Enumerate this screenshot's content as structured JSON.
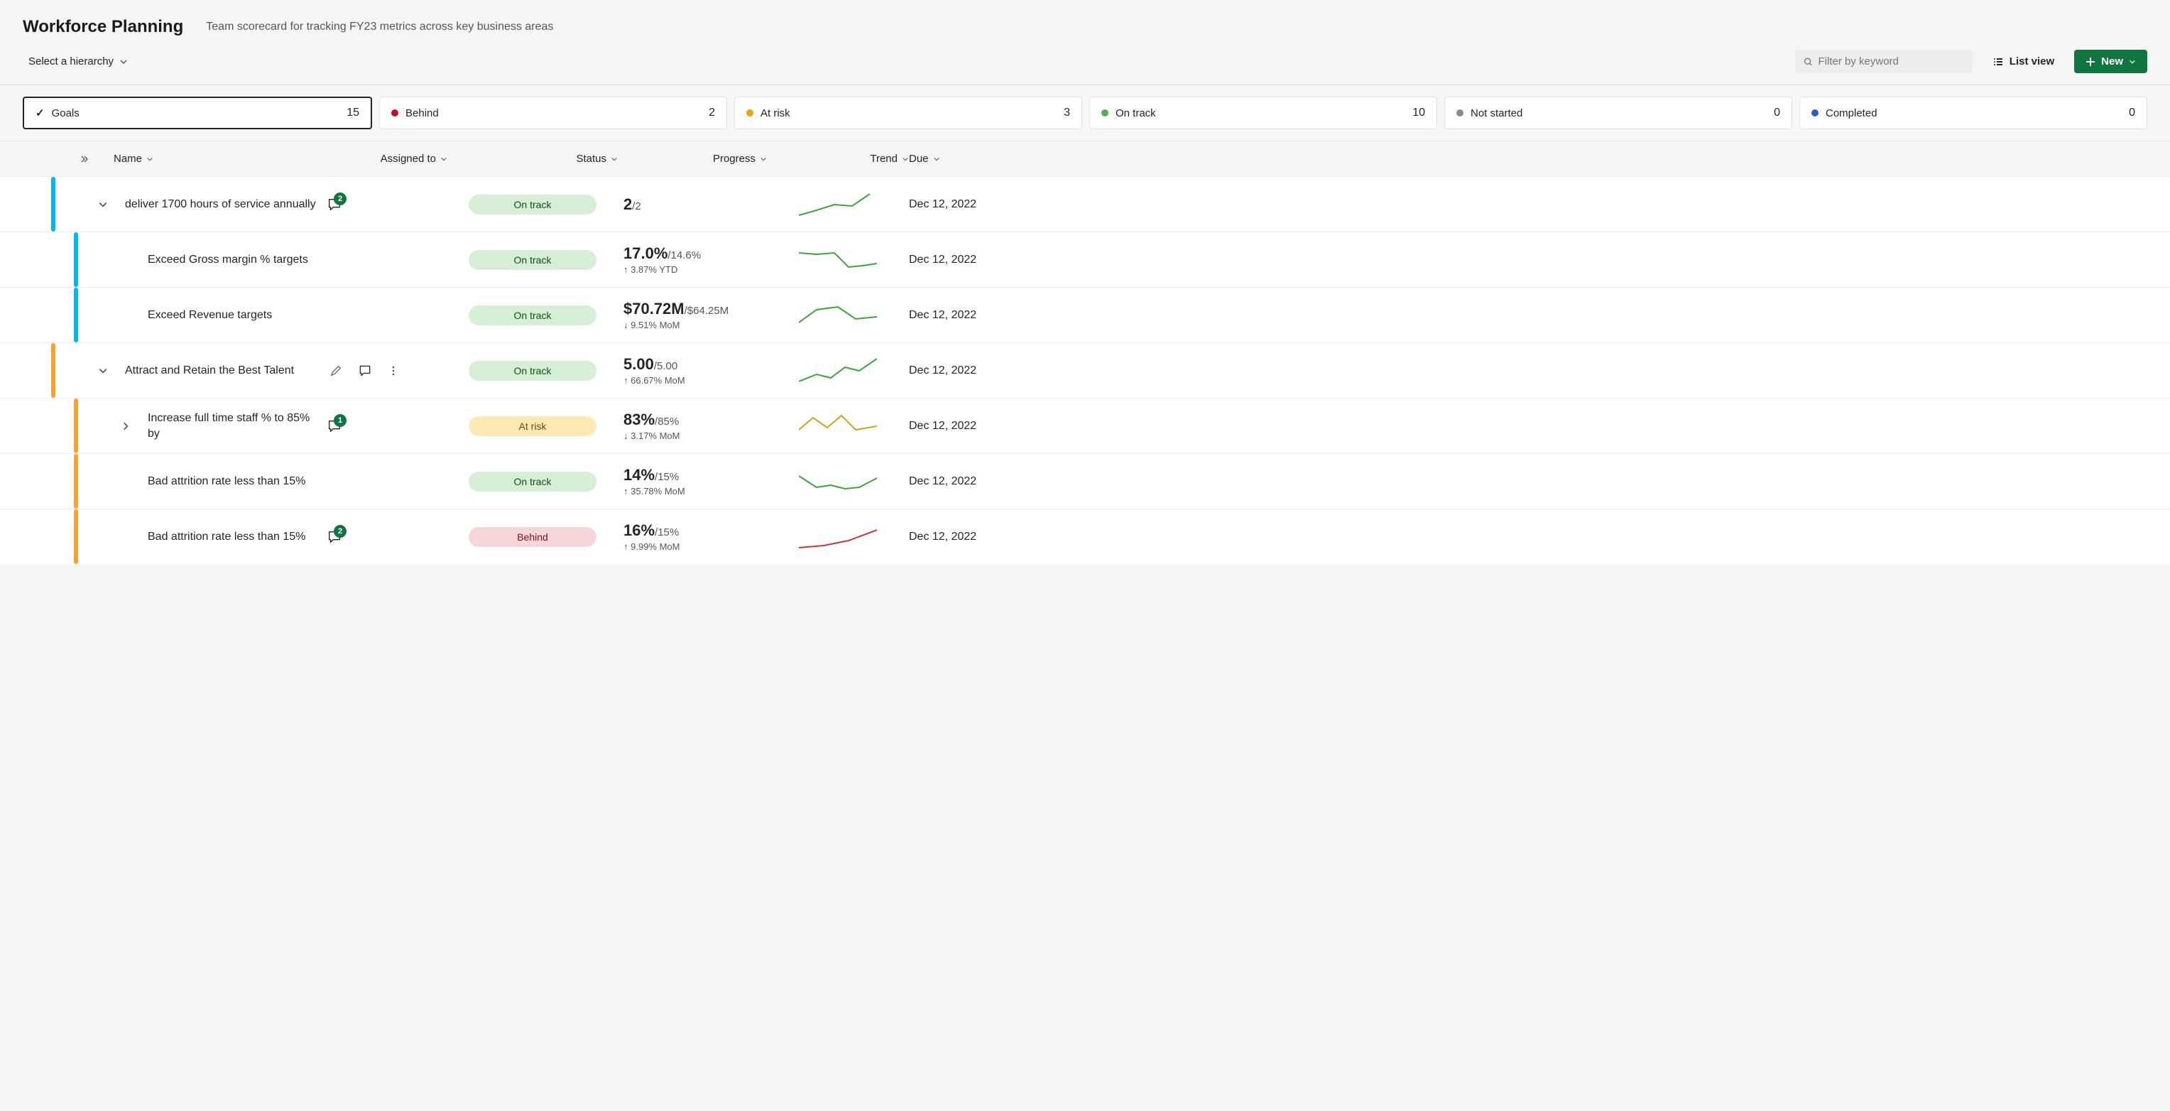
{
  "header": {
    "title": "Workforce Planning",
    "subtitle": "Team scorecard for tracking FY23 metrics across key business areas"
  },
  "toolbar": {
    "hierarchy_label": "Select a hierarchy",
    "search_placeholder": "Filter by keyword",
    "list_view_label": "List view",
    "new_label": "New"
  },
  "filters": {
    "goals": {
      "label": "Goals",
      "count": 15
    },
    "behind": {
      "label": "Behind",
      "count": 2
    },
    "atrisk": {
      "label": "At risk",
      "count": 3
    },
    "ontrack": {
      "label": "On track",
      "count": 10
    },
    "notstarted": {
      "label": "Not started",
      "count": 0
    },
    "completed": {
      "label": "Completed",
      "count": 0
    }
  },
  "columns": {
    "name": "Name",
    "assigned": "Assigned to",
    "status": "Status",
    "progress": "Progress",
    "trend": "Trend",
    "due": "Due"
  },
  "status_labels": {
    "ontrack": "On track",
    "atrisk": "At risk",
    "behind": "Behind"
  },
  "rows": [
    {
      "name": "deliver 1700 hours of service annually",
      "comments": 2,
      "progress_main": "2",
      "progress_target": "/2",
      "progress_sub": "",
      "due": "Dec 12, 2022"
    },
    {
      "name": "Exceed Gross margin % targets",
      "progress_main": "17.0%",
      "progress_target": "/14.6%",
      "progress_sub": "3.87% YTD",
      "due": "Dec 12, 2022"
    },
    {
      "name": "Exceed Revenue targets",
      "progress_main": "$70.72M",
      "progress_target": "/$64.25M",
      "progress_sub": "9.51% MoM",
      "due": "Dec 12, 2022"
    },
    {
      "name": "Attract and Retain the Best Talent",
      "progress_main": "5.00",
      "progress_target": "/5.00",
      "progress_sub": "66.67% MoM",
      "due": "Dec 12, 2022"
    },
    {
      "name": "Increase full time staff % to 85% by",
      "comments": 1,
      "progress_main": "83%",
      "progress_target": "/85%",
      "progress_sub": "3.17% MoM",
      "due": "Dec 12, 2022"
    },
    {
      "name": "Bad attrition rate less than 15%",
      "progress_main": "14%",
      "progress_target": "/15%",
      "progress_sub": "35.78% MoM",
      "due": "Dec 12, 2022"
    },
    {
      "name": "Bad attrition rate less than 15%",
      "comments": 2,
      "progress_main": "16%",
      "progress_target": "/15%",
      "progress_sub": "9.99% MoM",
      "due": "Dec 12, 2022"
    }
  ]
}
